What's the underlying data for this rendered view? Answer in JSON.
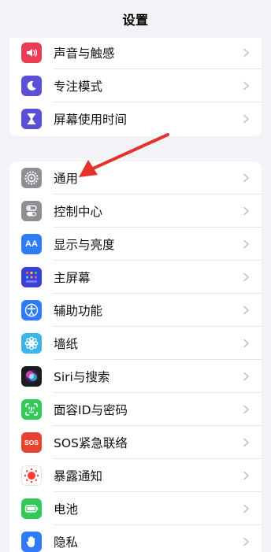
{
  "header": {
    "title": "设置"
  },
  "group1": {
    "items": [
      {
        "label": "声音与触感",
        "icon": "speaker-icon",
        "color": "#ec3b55"
      },
      {
        "label": "专注模式",
        "icon": "moon-icon",
        "color": "#5b4fd6"
      },
      {
        "label": "屏幕使用时间",
        "icon": "hourglass-icon",
        "color": "#5b4fd6"
      }
    ]
  },
  "group2": {
    "items": [
      {
        "label": "通用",
        "icon": "gear-icon",
        "color": "#8e8e93"
      },
      {
        "label": "控制中心",
        "icon": "toggles-icon",
        "color": "#8e8e93"
      },
      {
        "label": "显示与亮度",
        "icon": "text-size-icon",
        "color": "#2f7cf6",
        "glyph": "AA"
      },
      {
        "label": "主屏幕",
        "icon": "home-grid-icon",
        "color": "#3a3fd8"
      },
      {
        "label": "辅助功能",
        "icon": "accessibility-icon",
        "color": "#2f7cf6"
      },
      {
        "label": "墙纸",
        "icon": "flower-icon",
        "color": "#3ab6e8"
      },
      {
        "label": "Siri与搜索",
        "icon": "siri-icon",
        "color": "#1c1c1e"
      },
      {
        "label": "面容ID与密码",
        "icon": "face-id-icon",
        "color": "#34c759"
      },
      {
        "label": "SOS紧急联络",
        "icon": "sos-icon",
        "color": "#e8432f",
        "glyph": "SOS"
      },
      {
        "label": "暴露通知",
        "icon": "exposure-icon",
        "color": "#ffffff"
      },
      {
        "label": "电池",
        "icon": "battery-icon",
        "color": "#34c759"
      },
      {
        "label": "隐私",
        "icon": "hand-icon",
        "color": "#2f7cf6"
      }
    ]
  }
}
